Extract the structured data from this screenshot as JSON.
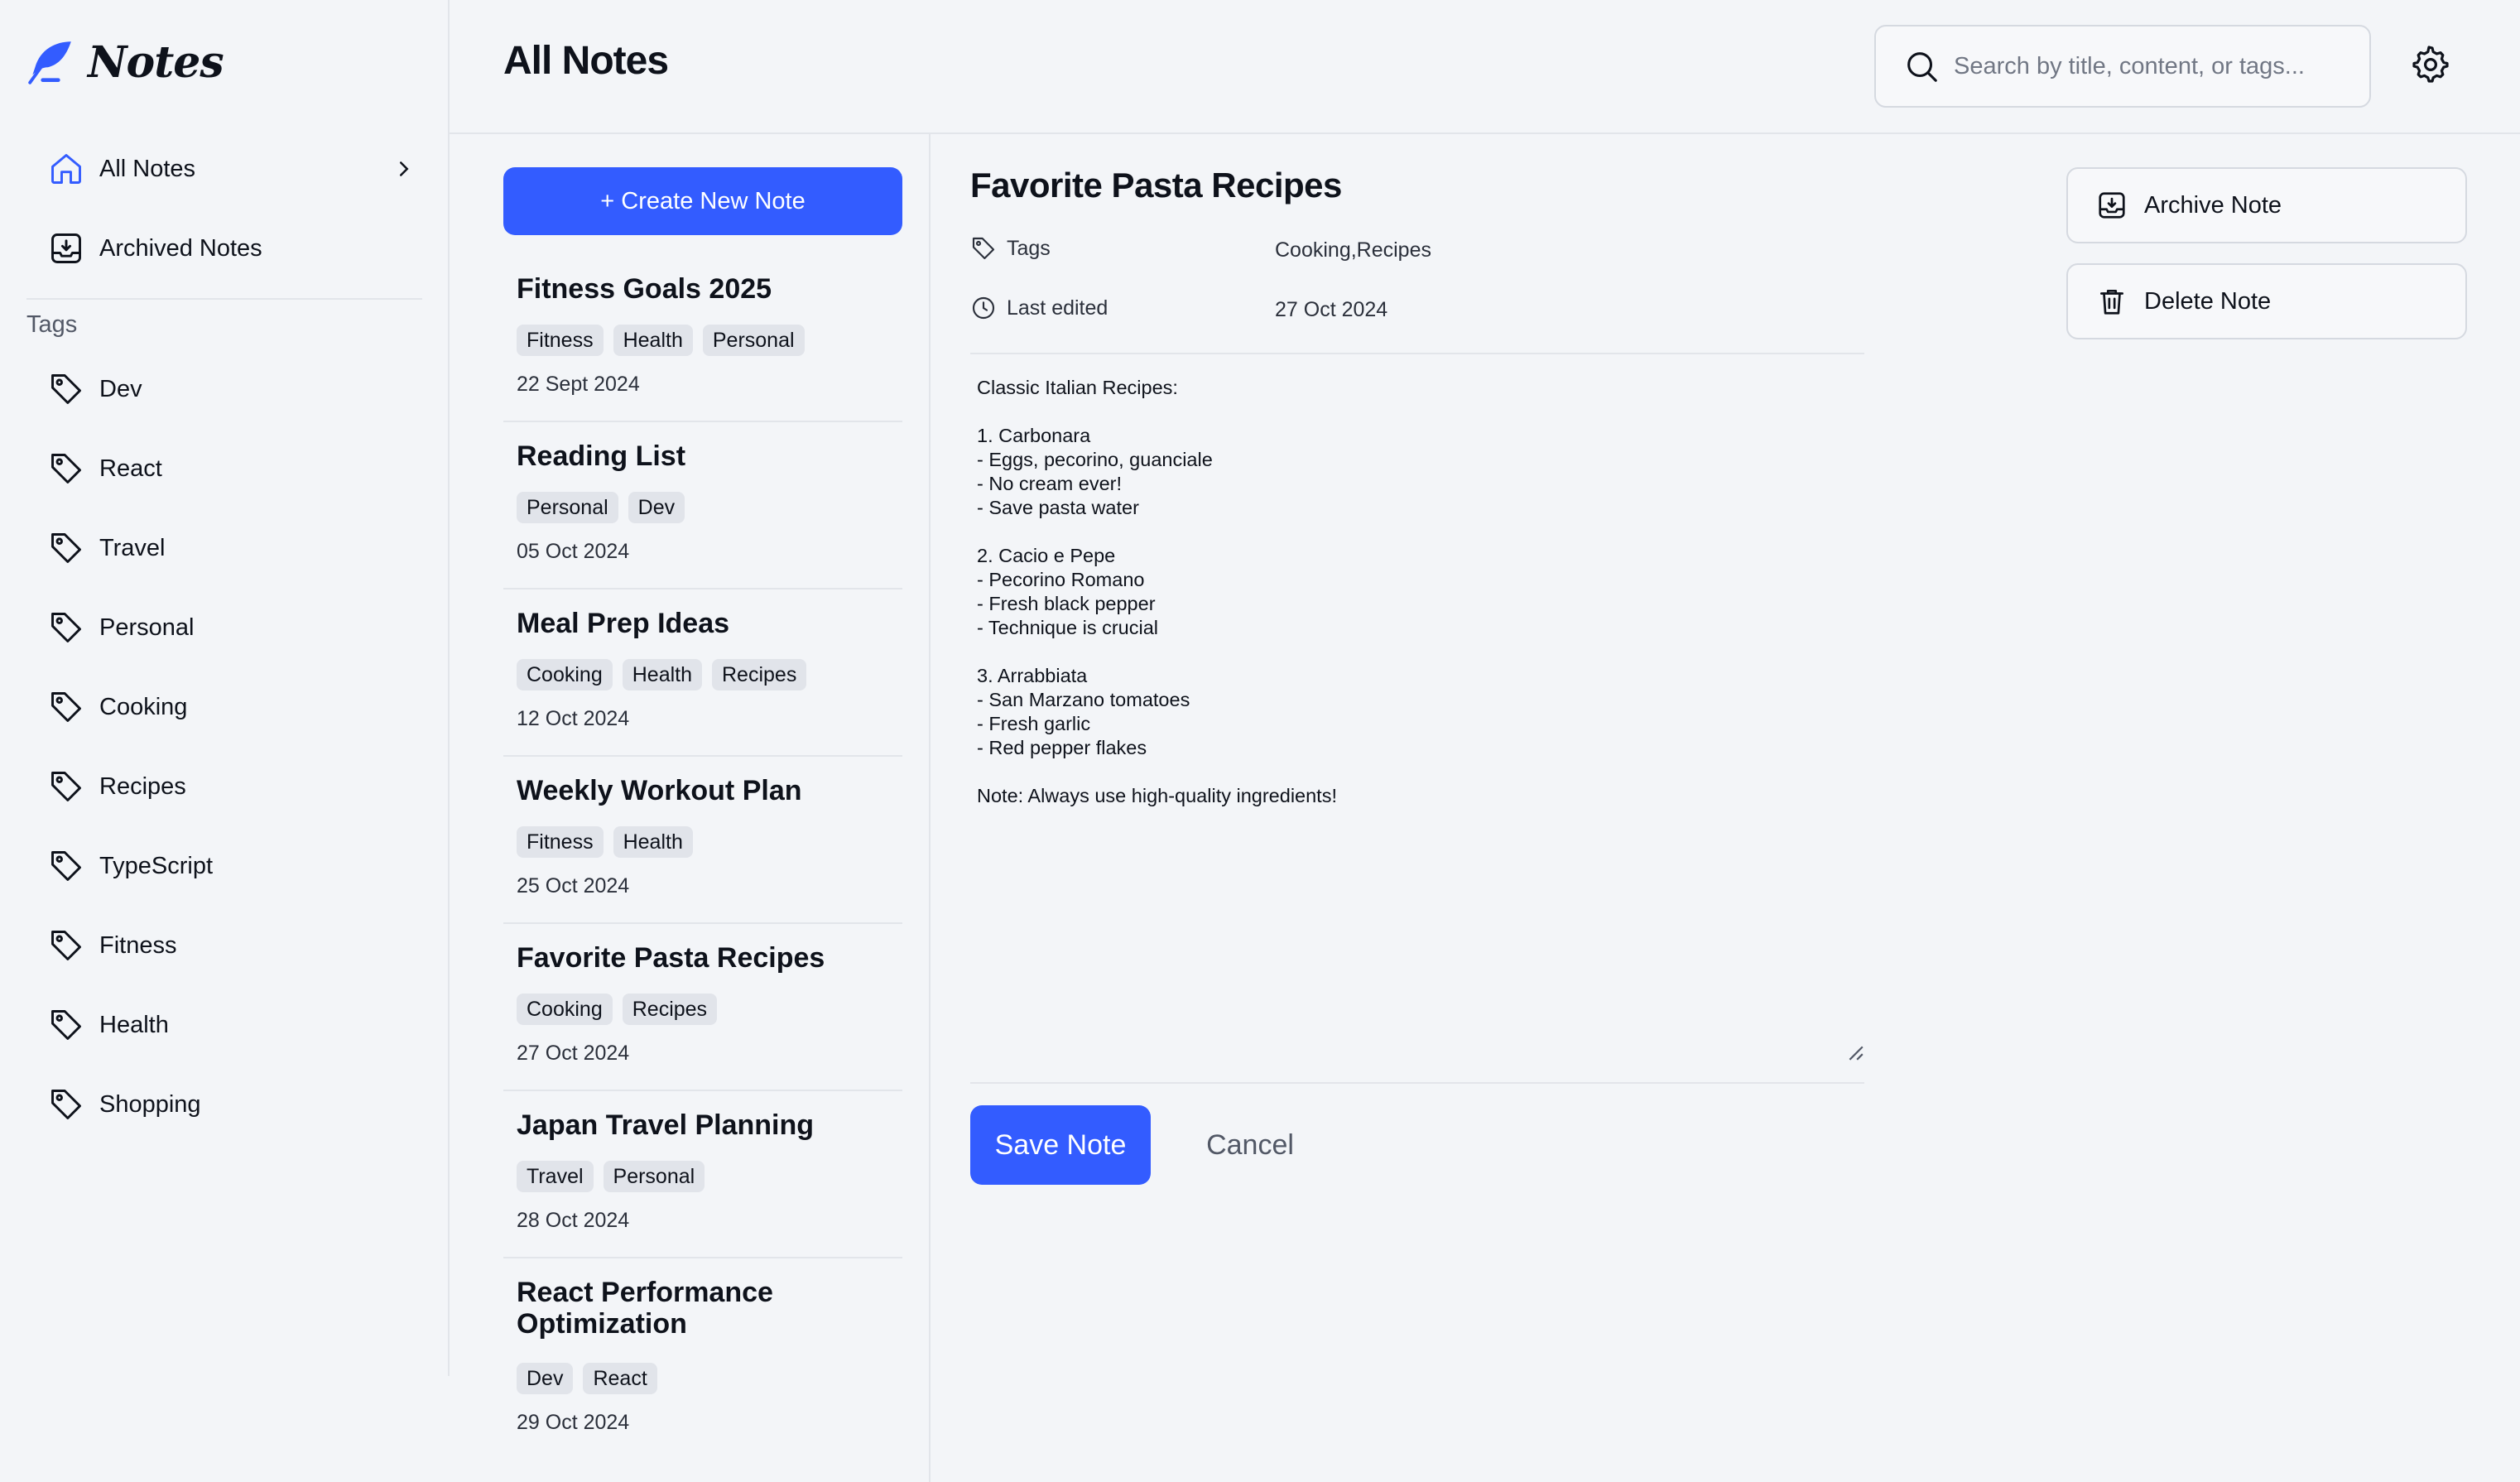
{
  "app": {
    "logo_text": "Notes"
  },
  "sidebar": {
    "nav": [
      {
        "label": "All Notes",
        "icon": "home-icon",
        "active": true
      },
      {
        "label": "Archived Notes",
        "icon": "archive-icon"
      }
    ],
    "tags_heading": "Tags",
    "tags": [
      "Dev",
      "React",
      "Travel",
      "Personal",
      "Cooking",
      "Recipes",
      "TypeScript",
      "Fitness",
      "Health",
      "Shopping"
    ]
  },
  "header": {
    "title": "All Notes",
    "search_placeholder": "Search by title, content, or tags..."
  },
  "list": {
    "create_label": "+ Create New Note",
    "notes": [
      {
        "title": "Fitness Goals 2025",
        "tags": [
          "Fitness",
          "Health",
          "Personal"
        ],
        "date": "22 Sept 2024"
      },
      {
        "title": "Reading List",
        "tags": [
          "Personal",
          "Dev"
        ],
        "date": "05 Oct 2024"
      },
      {
        "title": "Meal Prep Ideas",
        "tags": [
          "Cooking",
          "Health",
          "Recipes"
        ],
        "date": "12 Oct 2024"
      },
      {
        "title": "Weekly Workout Plan",
        "tags": [
          "Fitness",
          "Health"
        ],
        "date": "25 Oct 2024"
      },
      {
        "title": "Favorite Pasta Recipes",
        "tags": [
          "Cooking",
          "Recipes"
        ],
        "date": "27 Oct 2024"
      },
      {
        "title": "Japan Travel Planning",
        "tags": [
          "Travel",
          "Personal"
        ],
        "date": "28 Oct 2024"
      },
      {
        "title": "React Performance Optimization",
        "tags": [
          "Dev",
          "React"
        ],
        "date": "29 Oct 2024"
      }
    ]
  },
  "editor": {
    "title": "Favorite Pasta Recipes",
    "tags_label": "Tags",
    "tags_value": "Cooking,Recipes",
    "last_edited_label": "Last edited",
    "last_edited_value": "27 Oct 2024",
    "body": "Classic Italian Recipes:\n\n1. Carbonara\n- Eggs, pecorino, guanciale\n- No cream ever!\n- Save pasta water\n\n2. Cacio e Pepe\n- Pecorino Romano\n- Fresh black pepper\n- Technique is crucial\n\n3. Arrabbiata\n- San Marzano tomatoes\n- Fresh garlic\n- Red pepper flakes\n\nNote: Always use high-quality ingredients!",
    "save_label": "Save Note",
    "cancel_label": "Cancel"
  },
  "actions": {
    "archive_label": "Archive Note",
    "delete_label": "Delete Note"
  },
  "colors": {
    "accent": "#335cff",
    "background": "#f3f5f8",
    "chip": "#e1e4ea"
  }
}
